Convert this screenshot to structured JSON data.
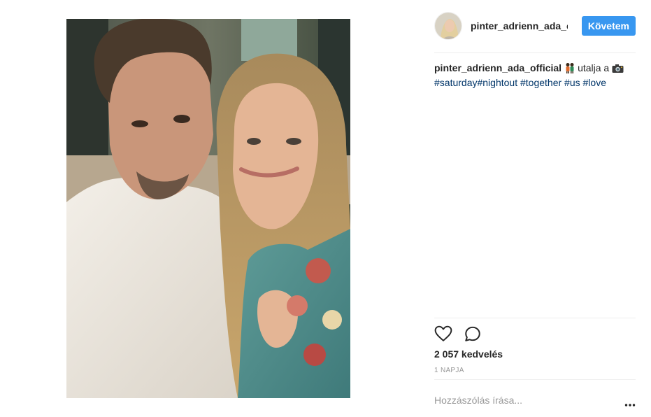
{
  "post": {
    "photo_icon": "selfie-photo"
  },
  "header": {
    "username": "pinter_adrienn_ada_official",
    "follow_label": "Követem",
    "avatar_icon": "profile-avatar"
  },
  "caption": {
    "username": "pinter_adrienn_ada_official",
    "emoji_1": "couple-emoji",
    "text": "utalja a",
    "emoji_2": "camera-emoji",
    "hashtags": [
      "#saturday",
      "#nightout",
      "#together",
      "#us",
      "#love"
    ]
  },
  "actions": {
    "like_icon": "heart-icon",
    "comment_icon": "comment-bubble-icon"
  },
  "likes_text": "2 057 kedvelés",
  "time_text": "1 NAPJA",
  "comment": {
    "placeholder": "Hozzászólás írása...",
    "more_icon": "more-options-icon"
  },
  "colors": {
    "accent": "#3897f0",
    "hashtag": "#003569",
    "muted": "#999999",
    "divider": "#efefef"
  }
}
